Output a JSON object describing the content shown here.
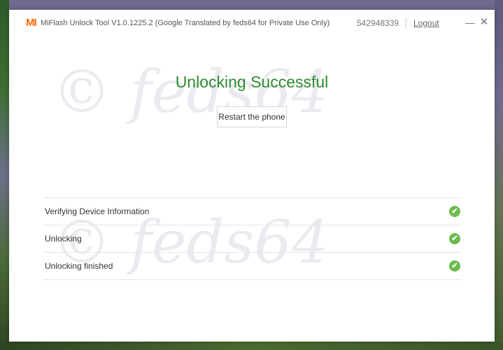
{
  "window": {
    "logo_text": "MI",
    "title": "MiFlash Unlock Tool V1.0.1225.2 (Google Translated by feds64 for Private Use Only)",
    "account_id": "542948339",
    "logout_label": "Logout",
    "minimize_glyph": "—",
    "close_glyph": "✕"
  },
  "watermark": {
    "text": "© feds64"
  },
  "main": {
    "headline": "Unlocking Successful",
    "restart_label": "Restart the phone"
  },
  "steps": [
    {
      "label": "Verifying Device Information",
      "status": "done"
    },
    {
      "label": "Unlocking",
      "status": "done"
    },
    {
      "label": "Unlocking finished",
      "status": "done"
    }
  ],
  "colors": {
    "brand": "#ff6700",
    "success": "#2f8a2f",
    "check": "#6cbb4c"
  },
  "icons": {
    "check": "✔"
  }
}
